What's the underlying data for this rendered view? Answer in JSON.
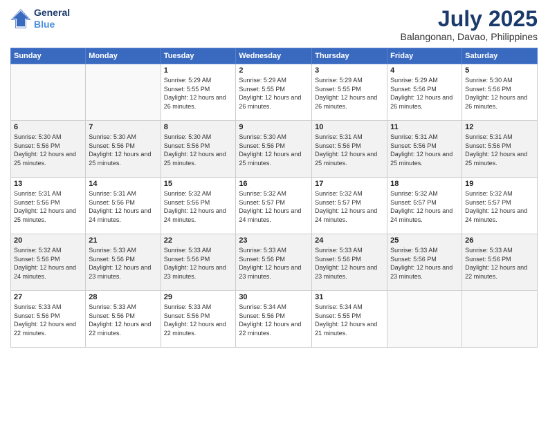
{
  "logo": {
    "line1": "General",
    "line2": "Blue"
  },
  "header": {
    "month": "July 2025",
    "location": "Balangonan, Davao, Philippines"
  },
  "weekdays": [
    "Sunday",
    "Monday",
    "Tuesday",
    "Wednesday",
    "Thursday",
    "Friday",
    "Saturday"
  ],
  "weeks": [
    [
      {
        "day": "",
        "info": ""
      },
      {
        "day": "",
        "info": ""
      },
      {
        "day": "1",
        "info": "Sunrise: 5:29 AM\nSunset: 5:55 PM\nDaylight: 12 hours and 26 minutes."
      },
      {
        "day": "2",
        "info": "Sunrise: 5:29 AM\nSunset: 5:55 PM\nDaylight: 12 hours and 26 minutes."
      },
      {
        "day": "3",
        "info": "Sunrise: 5:29 AM\nSunset: 5:55 PM\nDaylight: 12 hours and 26 minutes."
      },
      {
        "day": "4",
        "info": "Sunrise: 5:29 AM\nSunset: 5:56 PM\nDaylight: 12 hours and 26 minutes."
      },
      {
        "day": "5",
        "info": "Sunrise: 5:30 AM\nSunset: 5:56 PM\nDaylight: 12 hours and 26 minutes."
      }
    ],
    [
      {
        "day": "6",
        "info": "Sunrise: 5:30 AM\nSunset: 5:56 PM\nDaylight: 12 hours and 25 minutes."
      },
      {
        "day": "7",
        "info": "Sunrise: 5:30 AM\nSunset: 5:56 PM\nDaylight: 12 hours and 25 minutes."
      },
      {
        "day": "8",
        "info": "Sunrise: 5:30 AM\nSunset: 5:56 PM\nDaylight: 12 hours and 25 minutes."
      },
      {
        "day": "9",
        "info": "Sunrise: 5:30 AM\nSunset: 5:56 PM\nDaylight: 12 hours and 25 minutes."
      },
      {
        "day": "10",
        "info": "Sunrise: 5:31 AM\nSunset: 5:56 PM\nDaylight: 12 hours and 25 minutes."
      },
      {
        "day": "11",
        "info": "Sunrise: 5:31 AM\nSunset: 5:56 PM\nDaylight: 12 hours and 25 minutes."
      },
      {
        "day": "12",
        "info": "Sunrise: 5:31 AM\nSunset: 5:56 PM\nDaylight: 12 hours and 25 minutes."
      }
    ],
    [
      {
        "day": "13",
        "info": "Sunrise: 5:31 AM\nSunset: 5:56 PM\nDaylight: 12 hours and 25 minutes."
      },
      {
        "day": "14",
        "info": "Sunrise: 5:31 AM\nSunset: 5:56 PM\nDaylight: 12 hours and 24 minutes."
      },
      {
        "day": "15",
        "info": "Sunrise: 5:32 AM\nSunset: 5:56 PM\nDaylight: 12 hours and 24 minutes."
      },
      {
        "day": "16",
        "info": "Sunrise: 5:32 AM\nSunset: 5:57 PM\nDaylight: 12 hours and 24 minutes."
      },
      {
        "day": "17",
        "info": "Sunrise: 5:32 AM\nSunset: 5:57 PM\nDaylight: 12 hours and 24 minutes."
      },
      {
        "day": "18",
        "info": "Sunrise: 5:32 AM\nSunset: 5:57 PM\nDaylight: 12 hours and 24 minutes."
      },
      {
        "day": "19",
        "info": "Sunrise: 5:32 AM\nSunset: 5:57 PM\nDaylight: 12 hours and 24 minutes."
      }
    ],
    [
      {
        "day": "20",
        "info": "Sunrise: 5:32 AM\nSunset: 5:56 PM\nDaylight: 12 hours and 24 minutes."
      },
      {
        "day": "21",
        "info": "Sunrise: 5:33 AM\nSunset: 5:56 PM\nDaylight: 12 hours and 23 minutes."
      },
      {
        "day": "22",
        "info": "Sunrise: 5:33 AM\nSunset: 5:56 PM\nDaylight: 12 hours and 23 minutes."
      },
      {
        "day": "23",
        "info": "Sunrise: 5:33 AM\nSunset: 5:56 PM\nDaylight: 12 hours and 23 minutes."
      },
      {
        "day": "24",
        "info": "Sunrise: 5:33 AM\nSunset: 5:56 PM\nDaylight: 12 hours and 23 minutes."
      },
      {
        "day": "25",
        "info": "Sunrise: 5:33 AM\nSunset: 5:56 PM\nDaylight: 12 hours and 23 minutes."
      },
      {
        "day": "26",
        "info": "Sunrise: 5:33 AM\nSunset: 5:56 PM\nDaylight: 12 hours and 22 minutes."
      }
    ],
    [
      {
        "day": "27",
        "info": "Sunrise: 5:33 AM\nSunset: 5:56 PM\nDaylight: 12 hours and 22 minutes."
      },
      {
        "day": "28",
        "info": "Sunrise: 5:33 AM\nSunset: 5:56 PM\nDaylight: 12 hours and 22 minutes."
      },
      {
        "day": "29",
        "info": "Sunrise: 5:33 AM\nSunset: 5:56 PM\nDaylight: 12 hours and 22 minutes."
      },
      {
        "day": "30",
        "info": "Sunrise: 5:34 AM\nSunset: 5:56 PM\nDaylight: 12 hours and 22 minutes."
      },
      {
        "day": "31",
        "info": "Sunrise: 5:34 AM\nSunset: 5:55 PM\nDaylight: 12 hours and 21 minutes."
      },
      {
        "day": "",
        "info": ""
      },
      {
        "day": "",
        "info": ""
      }
    ]
  ]
}
